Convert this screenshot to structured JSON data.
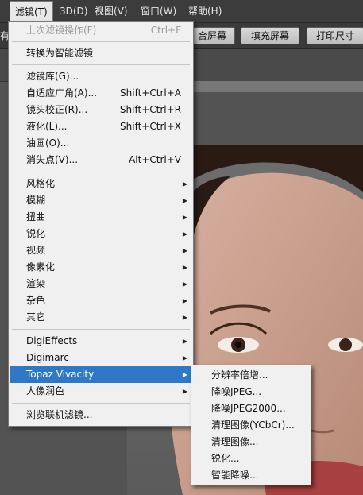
{
  "menubar": {
    "items": [
      {
        "label": "滤镜(T)"
      },
      {
        "label": "3D(D)"
      },
      {
        "label": "视图(V)"
      },
      {
        "label": "窗口(W)"
      },
      {
        "label": "帮助(H)"
      }
    ]
  },
  "options_bar": {
    "left_cut_text": "有",
    "buttons": [
      "合屏幕",
      "填充屏幕",
      "打印尺寸"
    ]
  },
  "filter_menu": {
    "last_filter": {
      "label": "上次滤镜操作(F)",
      "shortcut": "Ctrl+F"
    },
    "convert": "转换为智能滤镜",
    "gallery": "滤镜库(G)...",
    "adaptive_wide": {
      "label": "自适应广角(A)...",
      "shortcut": "Shift+Ctrl+A"
    },
    "lens_correction": {
      "label": "镜头校正(R)...",
      "shortcut": "Shift+Ctrl+R"
    },
    "liquify": {
      "label": "液化(L)...",
      "shortcut": "Shift+Ctrl+X"
    },
    "oil_paint": "油画(O)...",
    "vanishing_point": {
      "label": "消失点(V)...",
      "shortcut": "Alt+Ctrl+V"
    },
    "groups": [
      "风格化",
      "模糊",
      "扭曲",
      "锐化",
      "视频",
      "像素化",
      "渲染",
      "杂色",
      "其它"
    ],
    "plugins": [
      "DigiEffects",
      "Digimarc",
      "Topaz Vivacity",
      "人像润色"
    ],
    "browse_online": "浏览联机滤镜..."
  },
  "topaz_submenu": {
    "items": [
      "分辨率倍增...",
      "降噪JPEG...",
      "降噪JPEG2000...",
      "清理图像(YCbCr)...",
      "清理图像...",
      "锐化...",
      "智能降噪..."
    ]
  },
  "colors": {
    "highlight": "#2f78c8",
    "menu_bg": "#f0f0f0",
    "app_bg": "#535353"
  }
}
